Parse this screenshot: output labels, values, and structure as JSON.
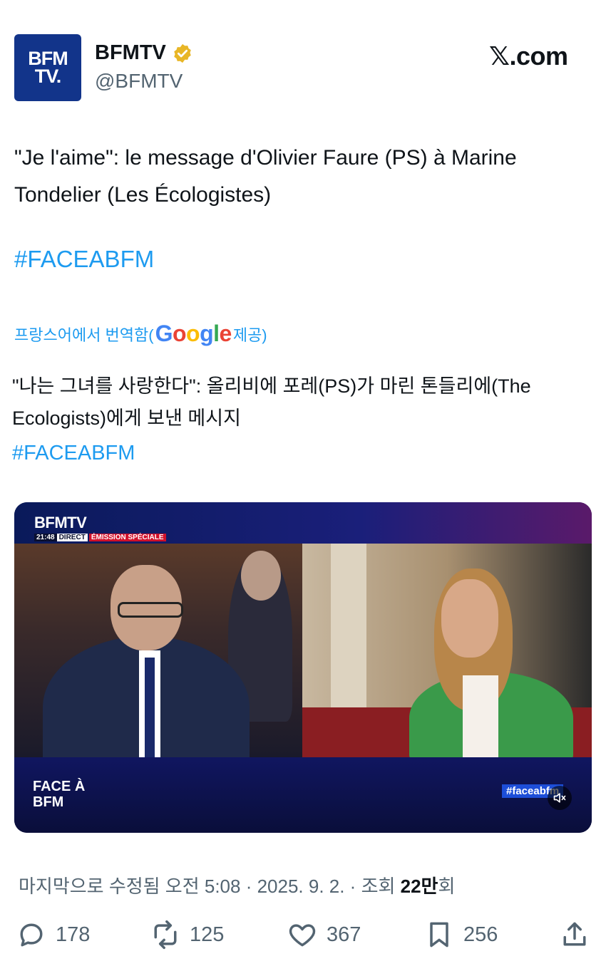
{
  "header": {
    "logo_line1": "BFM",
    "logo_line2": "TV.",
    "account_name": "BFMTV",
    "handle": "@BFMTV",
    "site": "𝕏.com",
    "verified_color": "#e8b626"
  },
  "tweet": {
    "text": "\"Je l'aime\": le message d'Olivier Faure (PS) à Marine Tondelier (Les Écologistes)",
    "hashtag": "#FACEABFM"
  },
  "translation": {
    "prefix": "프랑스어에서 번역함(",
    "provider": "Google",
    "suffix": " 제공)",
    "text": "\"나는 그녀를 사랑한다\": 올리비에 포레(PS)가 마린 톤들리에(The Ecologists)에게 보낸 메시지",
    "hashtag": "#FACEABFM"
  },
  "video": {
    "channel": "BFMTV",
    "time": "21:48",
    "direct": "DIRECT",
    "emission": "ÉMISSION SPÉCIALE",
    "show_line1": "FACE À",
    "show_line2": "BFM",
    "hashtag_overlay": "#faceabfm",
    "mute_icon": "speaker-muted-icon"
  },
  "meta": {
    "prefix": "마지막으로 수정됨 오전 5:08 · 2025. 9. 2.  · 조회 ",
    "views": "22만",
    "suffix": "회"
  },
  "actions": {
    "replies": "178",
    "reposts": "125",
    "likes": "367",
    "bookmarks": "256"
  },
  "colors": {
    "accent": "#1d9bf0",
    "logo_bg": "#12348a",
    "muted_text": "#536471"
  }
}
